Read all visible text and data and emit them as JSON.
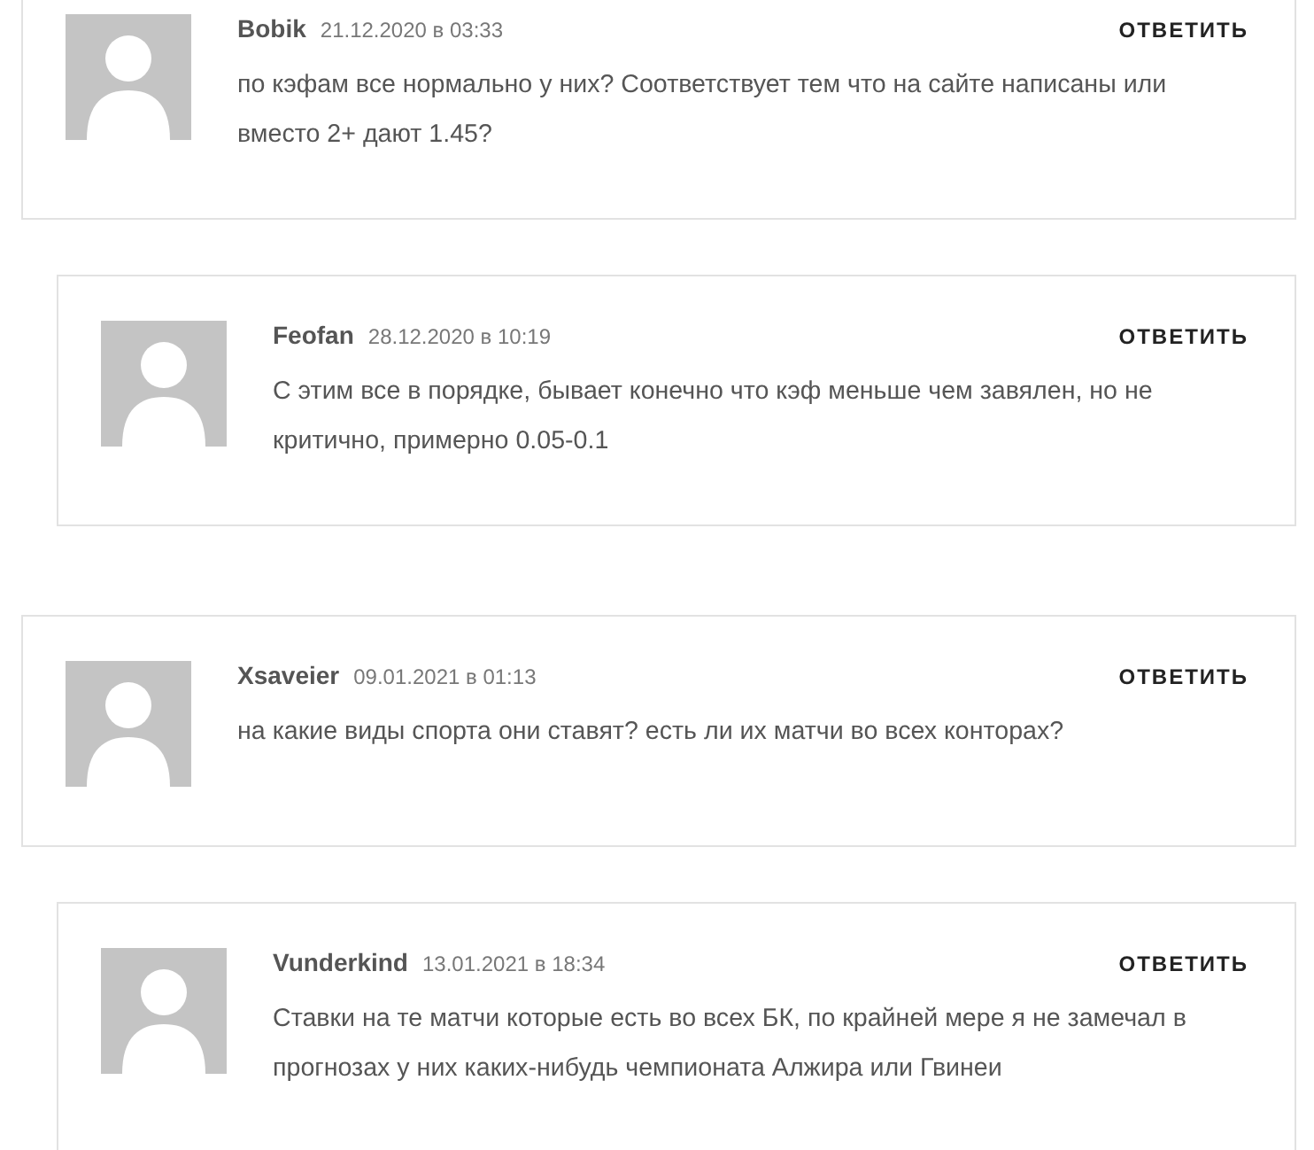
{
  "comments": [
    {
      "author": "Bobik",
      "date": "21.12.2020 в 03:33",
      "text": "по кэфам все нормально у них? Соответствует тем что на сайте написаны или вместо 2+ дают 1.45?",
      "reply": "ОТВЕТИТЬ",
      "children": [
        {
          "author": "Feofan",
          "date": "28.12.2020 в 10:19",
          "text": "С этим все в порядке, бывает конечно что кэф меньше чем завялен, но не критично, примерно 0.05-0.1",
          "reply": "ОТВЕТИТЬ"
        }
      ]
    },
    {
      "author": "Xsaveier",
      "date": "09.01.2021 в 01:13",
      "text": "на какие виды спорта они ставят? есть ли их матчи во всех конторах?",
      "reply": "ОТВЕТИТЬ",
      "children": [
        {
          "author": "Vunderkind",
          "date": "13.01.2021 в 18:34",
          "text": "Ставки на те матчи которые есть во всех БК, по крайней мере я не замечал в прогнозах у них каких-нибудь чемпионата Алжира или Гвинеи",
          "reply": "ОТВЕТИТЬ"
        }
      ]
    }
  ]
}
